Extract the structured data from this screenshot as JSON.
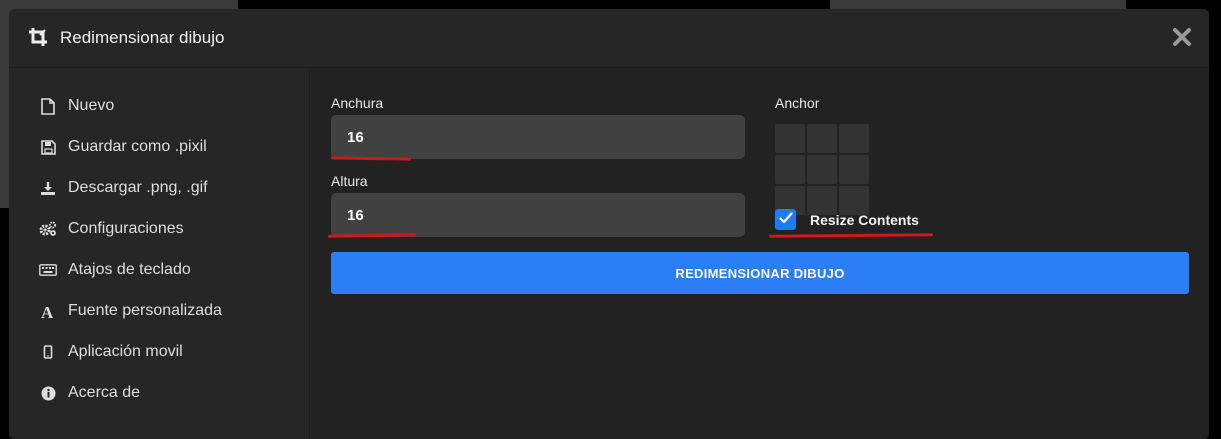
{
  "dialog": {
    "title": "Redimensionar dibujo",
    "header_icon": "crop-icon",
    "close_icon": "close-icon"
  },
  "sidebar": {
    "items": [
      {
        "label": "Nuevo",
        "icon": "file-icon"
      },
      {
        "label": "Guardar como .pixil",
        "icon": "save-icon"
      },
      {
        "label": "Descargar .png, .gif",
        "icon": "download-icon"
      },
      {
        "label": "Configuraciones",
        "icon": "gears-icon"
      },
      {
        "label": "Atajos de teclado",
        "icon": "keyboard-icon"
      },
      {
        "label": "Fuente personalizada",
        "icon": "font-icon"
      },
      {
        "label": "Aplicación movil",
        "icon": "mobile-icon"
      },
      {
        "label": "Acerca de",
        "icon": "info-icon"
      }
    ]
  },
  "form": {
    "width_label": "Anchura",
    "width_value": "16",
    "height_label": "Altura",
    "height_value": "16",
    "anchor_label": "Anchor",
    "resize_contents_label": "Resize Contents",
    "resize_contents_checked": true,
    "submit_label": "REDIMENSIONAR DIBUJO"
  },
  "colors": {
    "accent": "#2b7ef5",
    "annotation": "#d01818"
  }
}
